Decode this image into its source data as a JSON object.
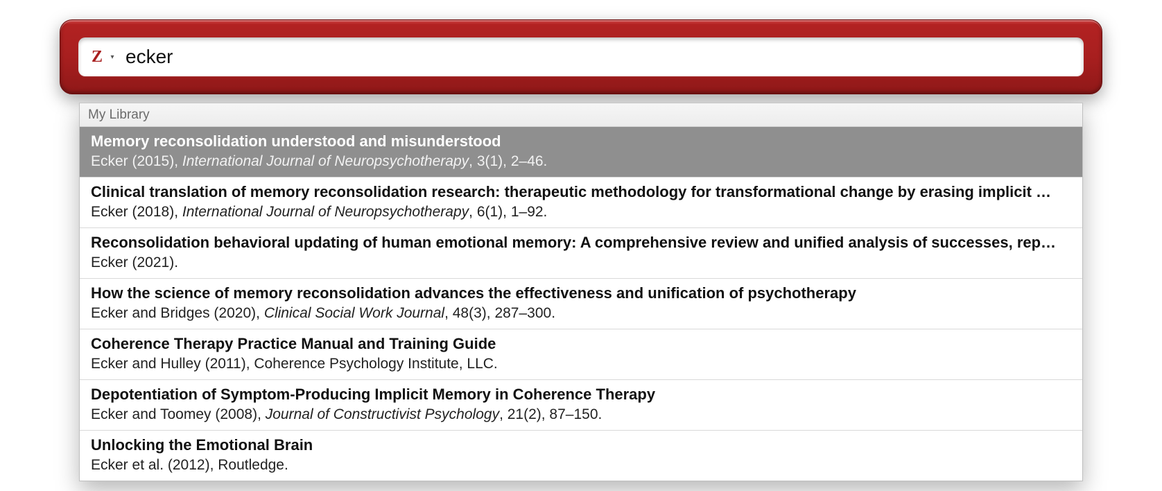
{
  "search": {
    "value": "ecker",
    "placeholder": ""
  },
  "results": {
    "header": "My Library",
    "items": [
      {
        "title": "Memory reconsolidation understood and misunderstood",
        "authors": "Ecker (2015)",
        "journal": "International Journal of Neuropsychotherapy",
        "locator": "3(1), 2–46.",
        "selected": true
      },
      {
        "title": "Clinical translation of memory reconsolidation research: therapeutic methodology for transformational change by erasing implicit …",
        "authors": "Ecker (2018)",
        "journal": "International Journal of Neuropsychotherapy",
        "locator": "6(1), 1–92.",
        "selected": false
      },
      {
        "title": "Reconsolidation behavioral updating of human emotional memory: A comprehensive review and unified analysis of successes, rep…",
        "authors": "Ecker (2021).",
        "journal": "",
        "locator": "",
        "selected": false
      },
      {
        "title": "How the science of memory reconsolidation advances the effectiveness and unification of psychotherapy",
        "authors": "Ecker and Bridges (2020)",
        "journal": "Clinical Social Work Journal",
        "locator": "48(3), 287–300.",
        "selected": false
      },
      {
        "title": "Coherence Therapy Practice Manual and Training Guide",
        "authors": "Ecker and Hulley (2011), Coherence Psychology Institute, LLC.",
        "journal": "",
        "locator": "",
        "selected": false
      },
      {
        "title": "Depotentiation of Symptom-Producing Implicit Memory in Coherence Therapy",
        "authors": "Ecker and Toomey (2008)",
        "journal": "Journal of Constructivist Psychology",
        "locator": "21(2), 87–150.",
        "selected": false
      },
      {
        "title": "Unlocking the Emotional Brain",
        "authors": "Ecker et al. (2012), Routledge.",
        "journal": "",
        "locator": "",
        "selected": false
      }
    ]
  }
}
